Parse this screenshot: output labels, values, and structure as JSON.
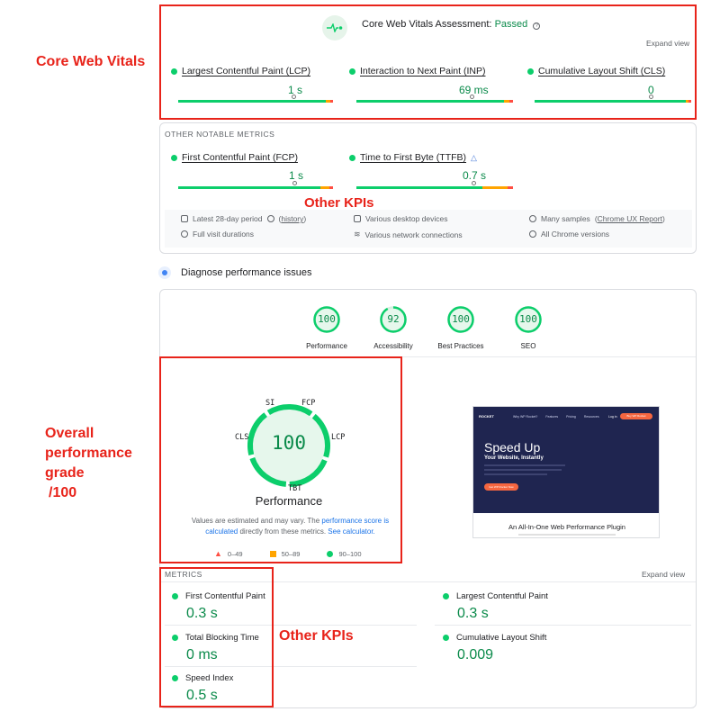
{
  "annotations": {
    "core_web_vitals": "Core Web Vitals",
    "other_kpis_1": "Other KPIs",
    "overall_line1": "Overall",
    "overall_line2": "performance",
    "overall_line3": "grade",
    "overall_line4": "/100",
    "other_kpis_2": "Other KPIs"
  },
  "cwv": {
    "title": "Core Web Vitals Assessment:",
    "status": "Passed",
    "expand": "Expand view",
    "metrics": [
      {
        "name": "Largest Contentful Paint (LCP)",
        "value": "1 s"
      },
      {
        "name": "Interaction to Next Paint (INP)",
        "value": "69 ms"
      },
      {
        "name": "Cumulative Layout Shift (CLS)",
        "value": "0"
      }
    ]
  },
  "other": {
    "header": "OTHER NOTABLE METRICS",
    "metrics": [
      {
        "name": "First Contentful Paint (FCP)",
        "value": "1 s"
      },
      {
        "name": "Time to First Byte (TTFB)",
        "value": "0.7 s"
      }
    ],
    "info": {
      "period": "Latest 28-day period",
      "history": "history",
      "devices": "Various desktop devices",
      "samples": "Many samples",
      "crux": "Chrome UX Report",
      "durations": "Full visit durations",
      "network": "Various network connections",
      "chrome": "All Chrome versions"
    }
  },
  "diagnose": {
    "title": "Diagnose performance issues"
  },
  "scores": [
    {
      "value": "100",
      "label": "Performance",
      "fraction": 1.0
    },
    {
      "value": "92",
      "label": "Accessibility",
      "fraction": 0.92
    },
    {
      "value": "100",
      "label": "Best Practices",
      "fraction": 1.0
    },
    {
      "value": "100",
      "label": "SEO",
      "fraction": 1.0
    }
  ],
  "big_gauge": {
    "value": "100",
    "label": "Performance",
    "segments": [
      "SI",
      "FCP",
      "LCP",
      "TBT",
      "CLS"
    ],
    "note_prefix": "Values are estimated and may vary. The",
    "note_link": "performance score is calculated",
    "note_mid": "directly from these metrics.",
    "note_link2": "See calculator.",
    "legend": [
      "0–49",
      "50–89",
      "90–100"
    ]
  },
  "screenshot": {
    "logo": "ROCKET",
    "nav": [
      "Why WP Rocket?",
      "Features",
      "Pricing",
      "Resources"
    ],
    "login": "Log in",
    "cta": "Buy WP Rocket",
    "headline": "Speed Up",
    "subheadline": "Your Website, Instantly",
    "button": "Get WP Rocket Now",
    "caption": "An All-In-One Web Performance Plugin"
  },
  "metrics": {
    "header": "METRICS",
    "expand": "Expand view",
    "items": [
      {
        "name": "First Contentful Paint",
        "value": "0.3 s"
      },
      {
        "name": "Largest Contentful Paint",
        "value": "0.3 s"
      },
      {
        "name": "Total Blocking Time",
        "value": "0 ms"
      },
      {
        "name": "Cumulative Layout Shift",
        "value": "0.009"
      },
      {
        "name": "Speed Index",
        "value": "0.5 s"
      }
    ]
  },
  "colors": {
    "good": "#0cce6b",
    "average": "#ffa400",
    "poor": "#ff4e42",
    "annotation": "#e8231a"
  }
}
